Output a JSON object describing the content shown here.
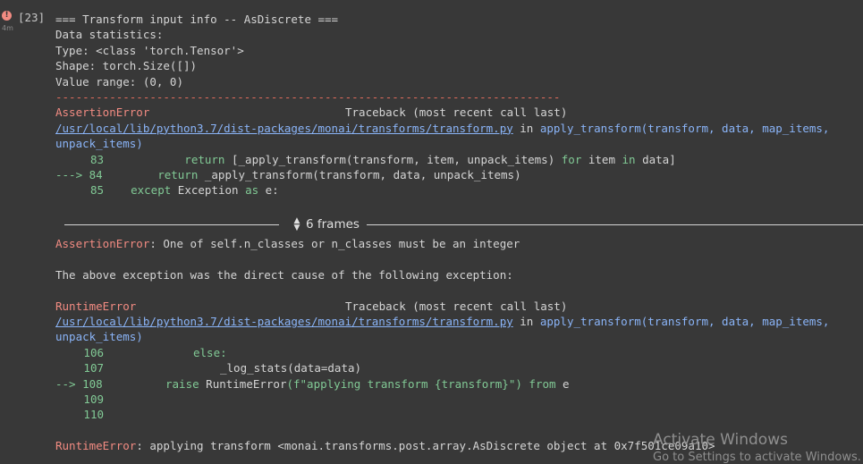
{
  "cell": {
    "execution_count": "[23]",
    "elapsed": "4m",
    "status_icon": "error-icon"
  },
  "output": {
    "header": [
      "=== Transform input info -- AsDiscrete ===",
      "Data statistics:",
      "Type: <class 'torch.Tensor'>",
      "Shape: torch.Size([])",
      "Value range: (0, 0)"
    ],
    "separator": "---------------------------------------------------------------------------",
    "tb1": {
      "error": "AssertionError",
      "traceback_label": "Traceback (most recent call last)",
      "path": "/usr/local/lib/python3.7/dist-packages/monai/transforms/transform.py",
      "in_word": " in ",
      "func": "apply_transform(transform, data, map_items,",
      "func_cont": "unpack_items)",
      "l83_num": "83",
      "l83_a": "            return ",
      "l83_b": "[_apply_transform(transform, item, unpack_items) ",
      "l83_for": "for",
      "l83_c": " item ",
      "l83_in": "in",
      "l83_d": " data]",
      "l84_arrow": "---> 84",
      "l84_a": "        return",
      "l84_b": " _apply_transform(transform, data, unpack_items)",
      "l85_num": "85",
      "l85_a": "    except",
      "l85_b": " Exception ",
      "l85_as": "as",
      "l85_c": " e:"
    },
    "frames_label": "6 frames",
    "assertion": {
      "error": "AssertionError",
      "message": ": One of self.n_classes or n_classes must be an integer"
    },
    "cause_text": "The above exception was the direct cause of the following exception:",
    "tb2": {
      "error": "RuntimeError",
      "traceback_label": "Traceback (most recent call last)",
      "path": "/usr/local/lib/python3.7/dist-packages/monai/transforms/transform.py",
      "in_word": " in ",
      "func": "apply_transform(transform, data, map_items,",
      "func_cont": "unpack_items)",
      "l106_num": "106",
      "l106_else": "else:",
      "l107_num": "107",
      "l107_code": "_log_stats(data=data)",
      "l108_arrow": "--> 108",
      "l108_raise": "raise",
      "l108_a": " RuntimeError",
      "l108_b": "(f\"applying transform {transform}\")",
      "l108_from": " from",
      "l108_c": " e",
      "l109_num": "109",
      "l110_num": "110"
    },
    "final": {
      "error": "RuntimeError",
      "message": ": applying transform <monai.transforms.post.array.AsDiscrete object at 0x7f501ce09a10>"
    }
  },
  "watermark": {
    "line1": "Activate Windows",
    "line2": "Go to Settings to activate Windows."
  }
}
